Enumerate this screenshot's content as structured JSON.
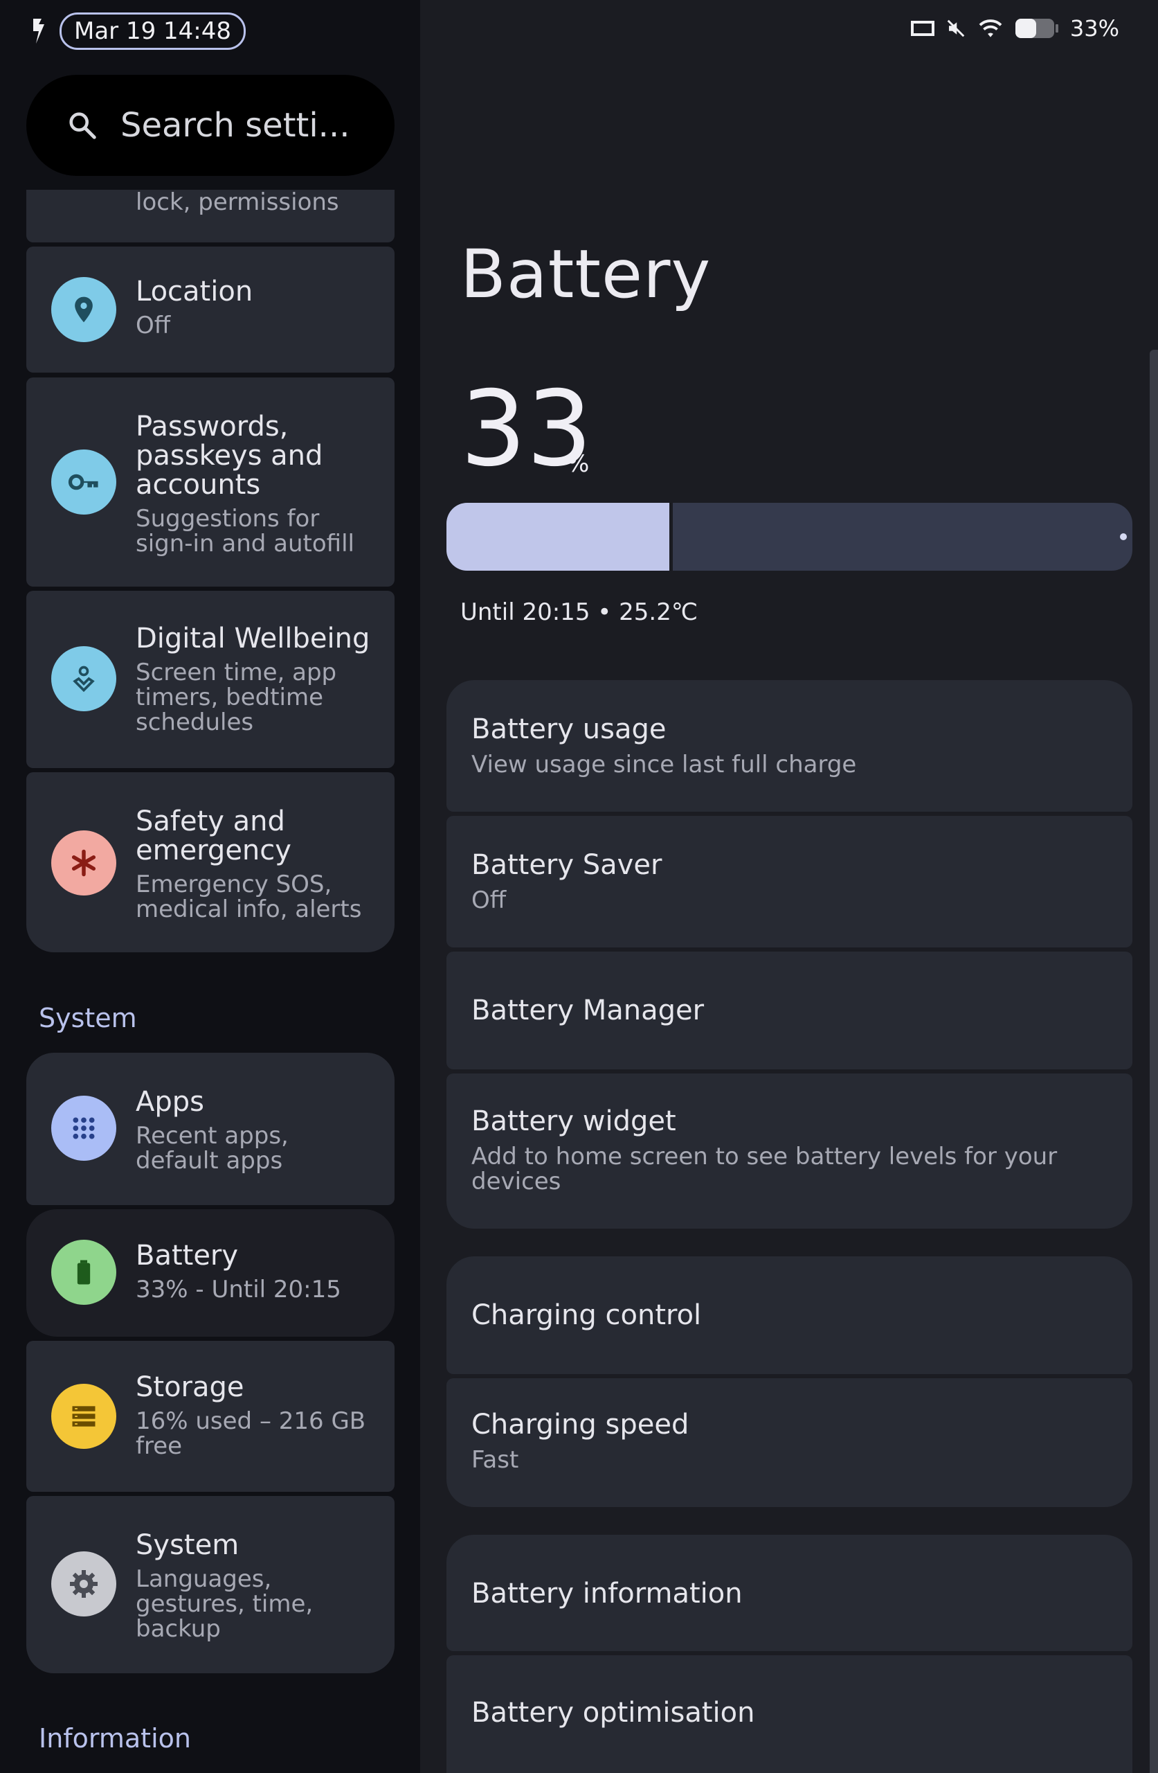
{
  "status_bar": {
    "datetime": "Mar 19 14:48",
    "battery_percent": "33%"
  },
  "sidebar": {
    "search_placeholder": "Search setti...",
    "partial_item_subtitle": "lock, permissions",
    "items": [
      {
        "title": "Location",
        "subtitle": "Off",
        "icon": "location-pin-icon",
        "color": "#7fcbe8"
      },
      {
        "title": "Passwords, passkeys and accounts",
        "subtitle": "Suggestions for sign-in and autofill",
        "icon": "key-icon",
        "color": "#7fcbe8"
      },
      {
        "title": "Digital Wellbeing",
        "subtitle": "Screen time, app timers, bedtime schedules",
        "icon": "wellbeing-icon",
        "color": "#7fcbe8"
      },
      {
        "title": "Safety and emergency",
        "subtitle": "Emergency SOS, medical info, alerts",
        "icon": "asterisk-icon",
        "color": "#f2a9a1"
      }
    ],
    "section_system": "System",
    "system_items": [
      {
        "title": "Apps",
        "subtitle": "Recent apps, default apps",
        "icon": "apps-grid-icon",
        "color": "#aabdf6"
      },
      {
        "title": "Battery",
        "subtitle": "33% - Until 20:15",
        "icon": "battery-icon",
        "color": "#8fd58c",
        "selected": true
      },
      {
        "title": "Storage",
        "subtitle": "16% used – 216 GB free",
        "icon": "storage-icon",
        "color": "#f4c637"
      },
      {
        "title": "System",
        "subtitle": "Languages, gestures, time, backup",
        "icon": "gear-icon",
        "color": "#c8c9cf"
      }
    ],
    "section_information": "Information"
  },
  "battery_page": {
    "title": "Battery",
    "level_number": "33",
    "level_unit": "%",
    "level_fraction": 0.33,
    "until_text": "Until 20:15 • 25.2℃",
    "groups": [
      [
        {
          "title": "Battery usage",
          "subtitle": "View usage since last full charge"
        },
        {
          "title": "Battery Saver",
          "subtitle": "Off"
        },
        {
          "title": "Battery Manager",
          "subtitle": ""
        },
        {
          "title": "Battery widget",
          "subtitle": "Add to home screen to see battery levels for your devices"
        }
      ],
      [
        {
          "title": "Charging control",
          "subtitle": ""
        },
        {
          "title": "Charging speed",
          "subtitle": "Fast"
        }
      ],
      [
        {
          "title": "Battery information",
          "subtitle": ""
        },
        {
          "title": "Battery optimisation",
          "subtitle": ""
        }
      ]
    ]
  },
  "colors": {
    "accent": "#b9c2ec",
    "bar_fill": "#c0c6ea",
    "bar_track": "#353a4d",
    "card": "#272a33"
  }
}
